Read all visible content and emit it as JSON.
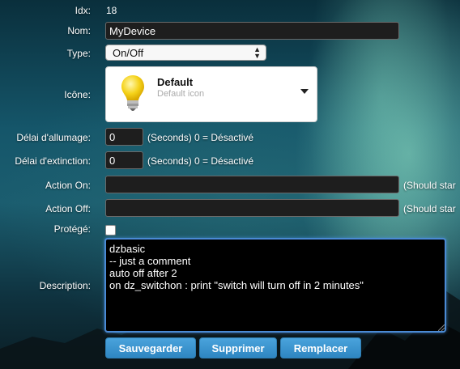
{
  "form": {
    "idx": {
      "label": "Idx:",
      "value": "18"
    },
    "name": {
      "label": "Nom:",
      "value": "MyDevice"
    },
    "type": {
      "label": "Type:",
      "value": "On/Off"
    },
    "icon": {
      "label": "Icône:",
      "title": "Default",
      "subtitle": "Default icon",
      "icon": "light-bulb-icon"
    },
    "on_delay": {
      "label": "Délai d'allumage:",
      "value": "0",
      "hint": "(Seconds) 0 = Désactivé"
    },
    "off_delay": {
      "label": "Délai d'extinction:",
      "value": "0",
      "hint": "(Seconds) 0 = Désactivé"
    },
    "action_on": {
      "label": "Action On:",
      "value": "",
      "hint": "(Should star"
    },
    "action_off": {
      "label": "Action Off:",
      "value": "",
      "hint": "(Should star"
    },
    "protected": {
      "label": "Protégé:",
      "checked": false
    },
    "description": {
      "label": "Description:",
      "value": "dzbasic\n-- just a comment\nauto off after 2\non dz_switchon : print \"switch will turn off in 2 minutes\""
    }
  },
  "buttons": {
    "save": "Sauvegarder",
    "delete": "Supprimer",
    "replace": "Remplacer"
  },
  "colors": {
    "button": "#2e86c1",
    "textarea_focus": "#4a8ad4",
    "input_bg": "#1e1e1e"
  }
}
